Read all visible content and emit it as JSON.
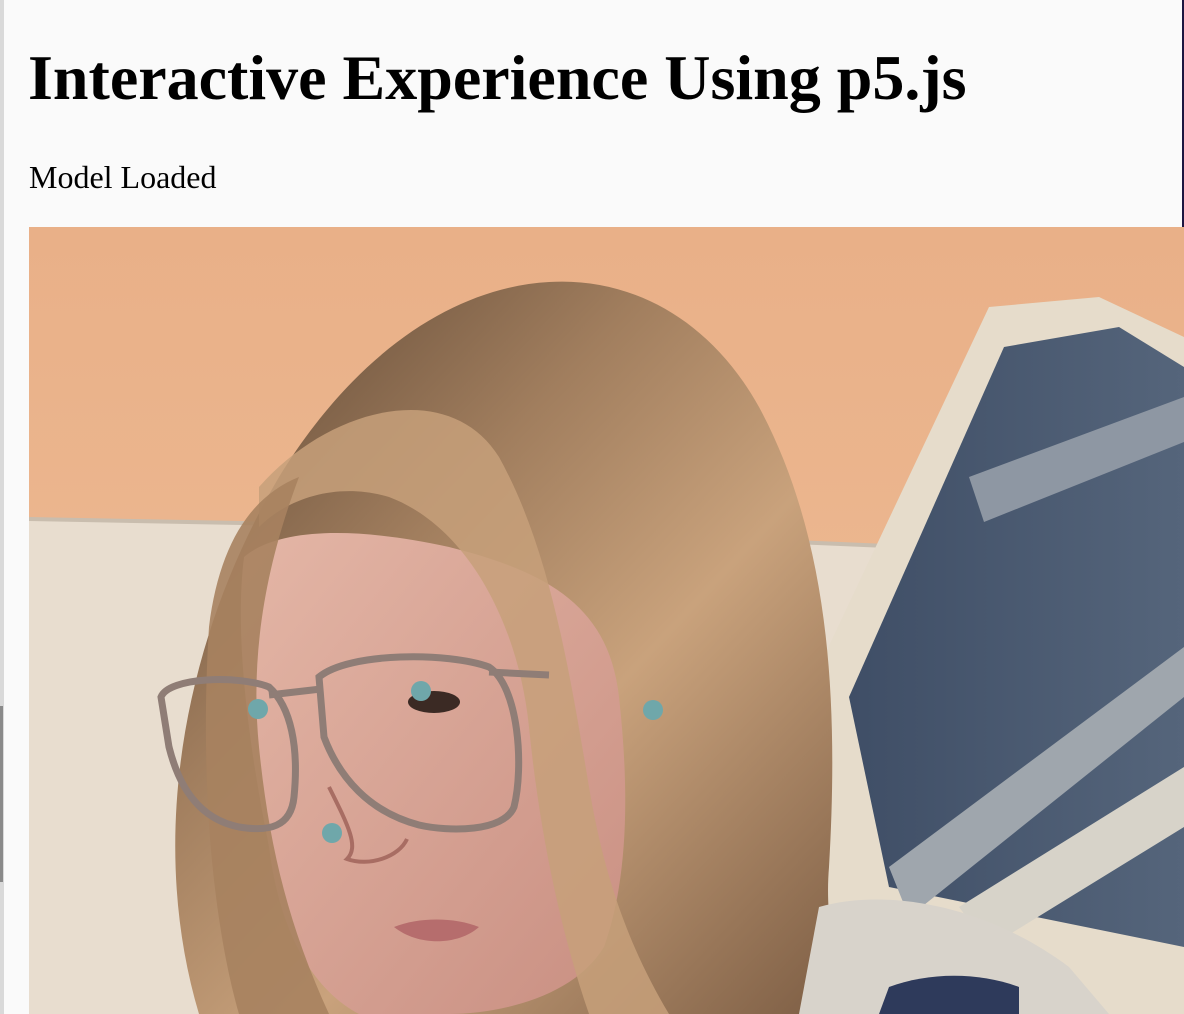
{
  "page": {
    "title": "Interactive Experience Using p5.js",
    "status": "Model Loaded"
  },
  "canvas": {
    "content": "webcam video feed",
    "keypoint_color": "#6fa7aa",
    "keypoints": [
      {
        "name": "right-eye"
      },
      {
        "name": "left-eye"
      },
      {
        "name": "left-ear"
      },
      {
        "name": "nose"
      }
    ]
  },
  "colors": {
    "page_background": "#fafafa",
    "wall": "#eab48a",
    "couch": "#e7ddd0",
    "pillow": "#4b5b72",
    "hair": "#8b6a4e",
    "skin": "#d8a99a"
  }
}
